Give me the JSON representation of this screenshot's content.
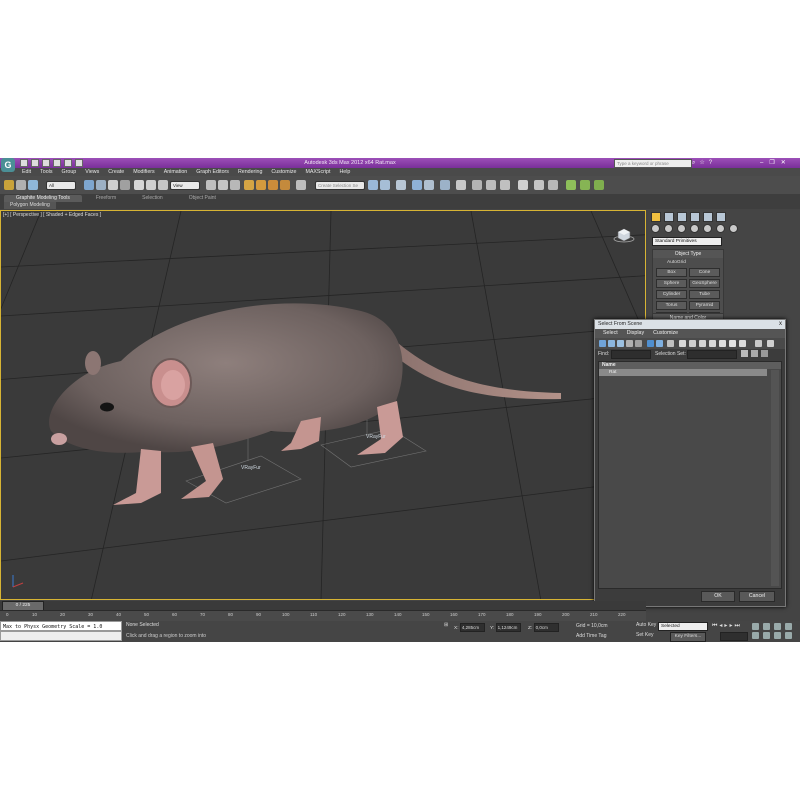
{
  "window": {
    "title": "Autodesk 3ds Max 2012 x64      Rat.max",
    "logo": "3ds-max-logo",
    "search_placeholder": "Type a keyword or phrase"
  },
  "menu": [
    "Edit",
    "Tools",
    "Group",
    "Views",
    "Create",
    "Modifiers",
    "Animation",
    "Graph Editors",
    "Rendering",
    "Customize",
    "MAXScript",
    "Help"
  ],
  "toolbar": {
    "selection_filter": "All",
    "reference_coord": "View",
    "named_selection_placeholder": "Create Selection Se"
  },
  "ribbon": {
    "tabs": [
      "Graphite Modeling Tools",
      "Freeform",
      "Selection",
      "Object Paint"
    ],
    "active_tab": "Graphite Modeling Tools",
    "panel_label": "Polygon Modeling"
  },
  "viewport": {
    "label": "[+] [ Perspective ] [ Shaded + Edged Faces ]",
    "helper_labels": [
      "VRayFur",
      "VRayFur"
    ],
    "accent_color": "#d7b434"
  },
  "command_panel": {
    "primitive_type": "Standard Primitives",
    "object_type_header": "Object Type",
    "autogrid_label": "AutoGrid",
    "buttons": [
      "Box",
      "Cone",
      "Sphere",
      "GeoSphere",
      "Cylinder",
      "Tube",
      "Torus",
      "Pyramid",
      "Teapot",
      "Plane"
    ],
    "name_color_header": "Name and Color"
  },
  "dialog": {
    "title": "Select From Scene",
    "close_label": "x",
    "menus": [
      "Select",
      "Display",
      "Customize"
    ],
    "find_label": "Find:",
    "selection_set_label": "Selection Set:",
    "column_name": "Name",
    "items": [
      "Rat"
    ],
    "ok_label": "OK",
    "cancel_label": "Cancel"
  },
  "timeline": {
    "slider_label": "0 / 225",
    "ticks": [
      "0",
      "10",
      "20",
      "30",
      "40",
      "50",
      "60",
      "70",
      "80",
      "90",
      "100",
      "110",
      "120",
      "130",
      "140",
      "150",
      "160",
      "170",
      "180",
      "190",
      "200",
      "210",
      "220"
    ]
  },
  "status": {
    "maxscript_line": "Max to Physx Geometry Scale = 1.0",
    "selection": "None Selected",
    "prompt": "Click and drag a region to zoom into",
    "x_value": "4,285cm",
    "y_value": "1,1249cm",
    "z_value": "0,0cm",
    "grid": "Grid = 10,0cm",
    "add_time_tag": "Add Time Tag",
    "auto_key": "Auto Key",
    "set_key": "Set Key",
    "key_mode": "Selected",
    "key_filters": "Key Filters..."
  }
}
